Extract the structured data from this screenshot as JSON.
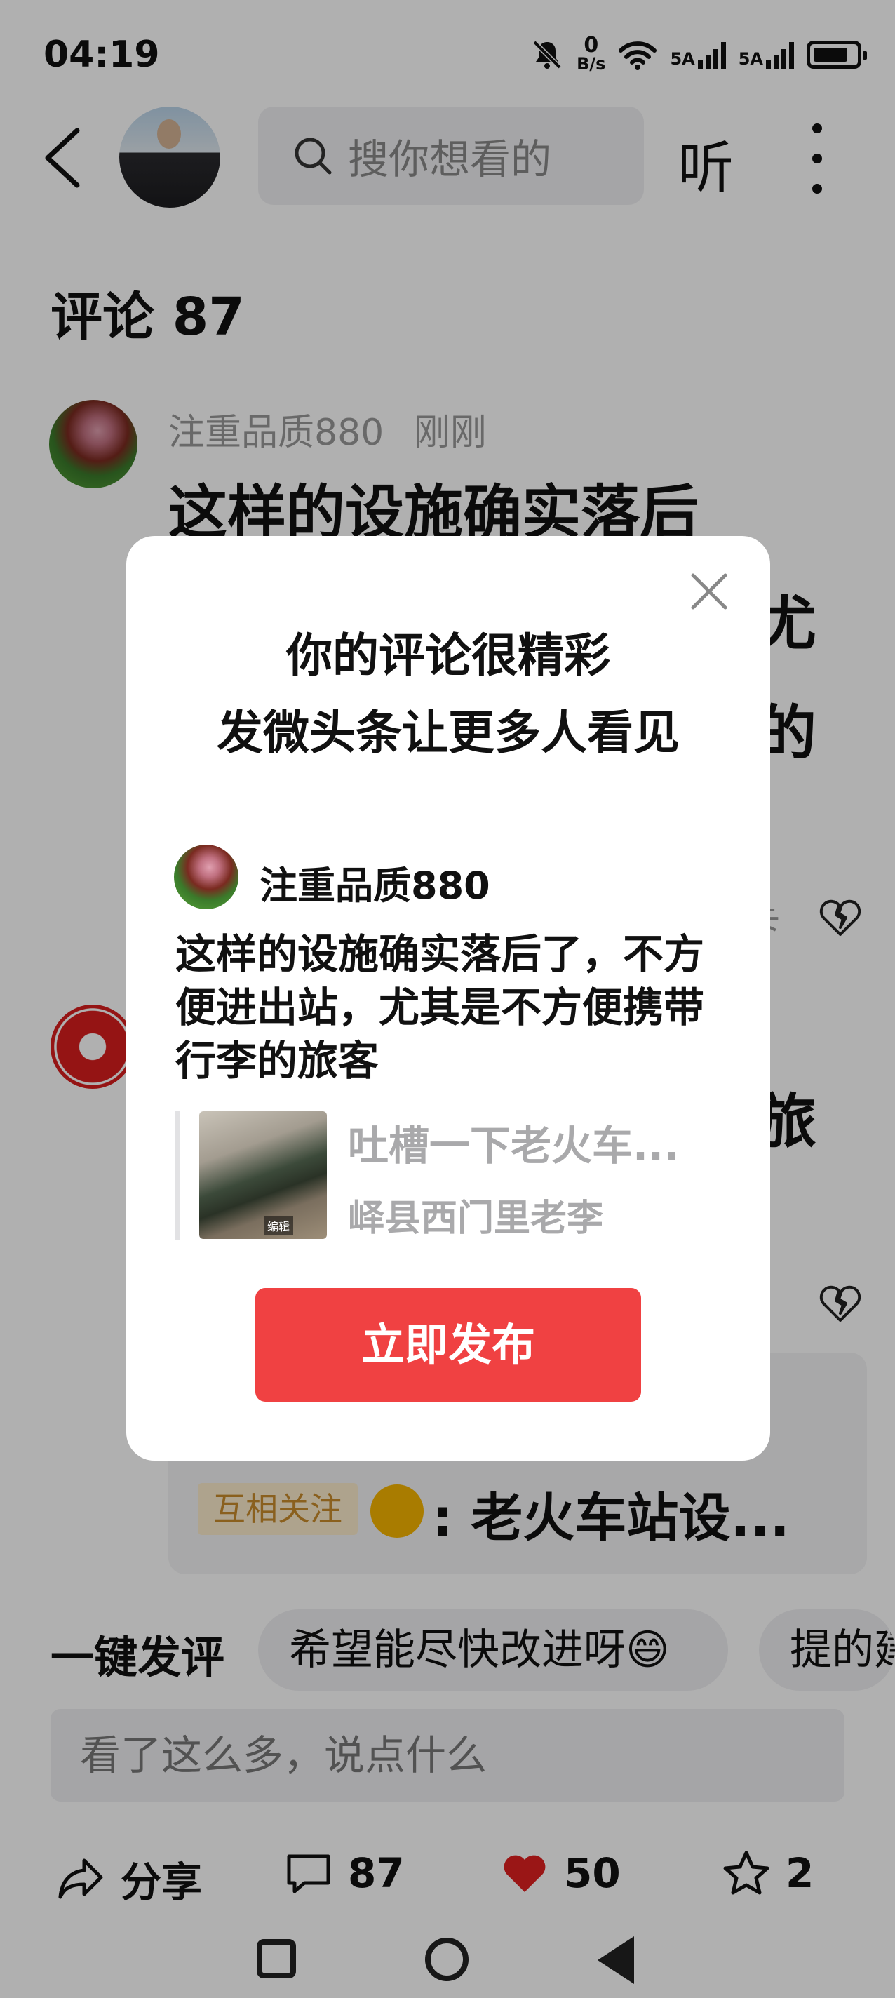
{
  "status_bar": {
    "time": "04:19",
    "net_speed_value": "0",
    "net_speed_unit": "B/s",
    "signal1_label": "5A",
    "signal2_label": "5A"
  },
  "nav": {
    "search_placeholder": "搜你想看的",
    "listen_label": "听"
  },
  "comments": {
    "title": "评论 87",
    "items": [
      {
        "username": "注重品质880",
        "time": "刚刚",
        "line1": "这样的设施确实落后",
        "line2_tail": "尤",
        "line3_tail": "的",
        "reply_tail": "卡"
      },
      {
        "line1_tail": "旅"
      }
    ],
    "reply_preview": {
      "tag": "互相关注",
      "text": ": 老火车站设..."
    }
  },
  "quick_reply": {
    "label": "一键发评",
    "chips": [
      "希望能尽快改进呀😄",
      "提的建"
    ]
  },
  "comment_input": {
    "placeholder": "看了这么多，说点什么"
  },
  "actions": {
    "share_label": "分享",
    "comment_count": "87",
    "like_count": "50",
    "favorite_count": "2"
  },
  "dialog": {
    "title_line1": "你的评论很精彩",
    "title_line2": "发微头条让更多人看见",
    "username": "注重品质880",
    "comment_text": "这样的设施确实落后了，不方便进出站，尤其是不方便携带行李的旅客",
    "link_title": "吐槽一下老火车...",
    "link_author": "峄县西门里老李",
    "thumb_tag": "编辑",
    "publish_label": "立即发布"
  },
  "colors": {
    "accent_red": "#f04142",
    "like_red": "#e02020",
    "tag_bg": "#fdeccd",
    "tag_text": "#c98c2c"
  },
  "icons": [
    "back-icon",
    "search-icon",
    "more-icon",
    "close-icon",
    "share-icon",
    "comment-icon",
    "heart-icon",
    "star-icon",
    "broken-heart-icon"
  ]
}
